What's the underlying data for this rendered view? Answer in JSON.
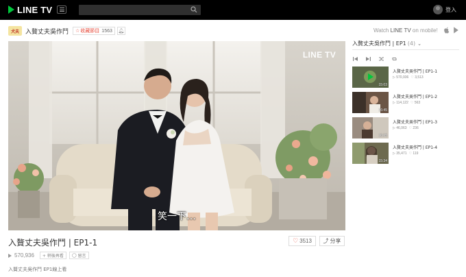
{
  "header": {
    "logo_text": "LINE TV",
    "search_placeholder": "",
    "login_label": "登入"
  },
  "show": {
    "logo_text": "犬夫",
    "title": "入贅丈夫吳作鬥",
    "fav_label": "收藏節目",
    "fav_count": "1563",
    "bell_icon": "bell-icon"
  },
  "mobile": {
    "prefix": "Watch ",
    "brand": "LINE TV",
    "suffix": " on mobile!"
  },
  "player": {
    "watermark": "LINE TV",
    "subtitle": "笑一下…"
  },
  "episode": {
    "title": "入贅丈夫吳作鬥 | EP1-1",
    "likes": "3513",
    "share_label": "分享",
    "views": "570,936",
    "add_label": "+ 稍後再看",
    "comment_label": "留言",
    "description": "入贅丈夫吳作鬥 EP1線上看"
  },
  "sidebar": {
    "title": "入贅丈夫吳作鬥 | EP1",
    "count": "(4)",
    "episodes": [
      {
        "name": "入贅丈夫吳作鬥 | EP1-1",
        "views": "570,936",
        "likes": "3,513",
        "duration": "15:03"
      },
      {
        "name": "入贅丈夫吳作鬥 | EP1-2",
        "views": "114,122",
        "likes": "563",
        "duration": "16:45"
      },
      {
        "name": "入贅丈夫吳作鬥 | EP1-3",
        "views": "46,063",
        "likes": "236",
        "duration": "16:05"
      },
      {
        "name": "入贅丈夫吳作鬥 | EP1-4",
        "views": "35,471",
        "likes": "119",
        "duration": "15:34"
      }
    ]
  },
  "colors": {
    "brand_green": "#00c73c",
    "topbar": "#000000",
    "heart_red": "#e74c3c"
  }
}
